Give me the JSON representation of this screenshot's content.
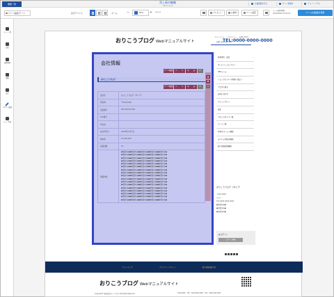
{
  "topbar": {
    "function_button": "機能一覧",
    "page_title": "売上高の編集",
    "page_subtitle": "2013-11-14",
    "links": [
      {
        "label": "企業概要を見る"
      },
      {
        "label": "サイト情報を"
      },
      {
        "label": "チュートリアル"
      }
    ]
  },
  "toolbar": {
    "parts_button": "パーツ編集モード",
    "display_device_label": "表示デバイス",
    "zoom_label": "ズーム：",
    "zoom_value": "85",
    "zoom_unit": "%",
    "zoom_minus": "−",
    "zoom_plus": "+",
    "ellipsis": "•••",
    "preview": "プレビュー",
    "publish": "公開中",
    "page_settings": "ページ設定",
    "edit_time_label": "ページ操作時間：",
    "edit_time_value": "2019/04/23 14:51:03",
    "save_button": "ページの編集を保存"
  },
  "sidebar": {
    "items": [
      {
        "label": "ページ一覧"
      },
      {
        "label": "追加"
      },
      {
        "label": "画像管理"
      },
      {
        "label": "履歴"
      },
      {
        "label": "表示"
      },
      {
        "label": "デザイン編集"
      },
      {
        "label": "ページ作成"
      }
    ]
  },
  "site": {
    "logo": "おりこうブログ",
    "logo_sub": "Webマニュアルサイト",
    "header_links": "・サイトマップ　・プライバシー　・お問い合わせ",
    "contact_label": "お問い合わせはこちら",
    "tel": "TEL:0000-0000-0000",
    "page_heading": "会社情報",
    "section_heading": "おりこうブログ",
    "controls": {
      "edit": "パーツ編集",
      "icons": [
        "⇔",
        "✎",
        "⧉",
        "▮",
        "✕"
      ],
      "up": "▲",
      "down": "▼",
      "plus": "+"
    },
    "table": [
      {
        "key": "会社名",
        "value": "おりこうブログ（ダミア）"
      },
      {
        "key": "所在地",
        "value": "〒000-0000"
      },
      {
        "key": "電話番号",
        "value": "000-0000-0000"
      },
      {
        "key": "FAX番号",
        "value": ""
      },
      {
        "key": "代表者",
        "value": ""
      },
      {
        "key": "設立年月日",
        "value": "2009年11月1日"
      },
      {
        "key": "資本金",
        "value": "10,000,000"
      },
      {
        "key": "従業員数",
        "value": "10"
      }
    ],
    "business_key": "事業内容",
    "business_lines": [
      "●事業内容●●事業内容●●事業内容●●事業内容●●事業内容●",
      "●事業内容●●事業内容●●事業内容●●事業内容●●事業内容●",
      "●事業内容●●事業内容●●事業内容●●事業内容●●事業内容●",
      "●事業内容●●事業内容●●事業内容●●事業内容●●事業内容●",
      "●事業内容●●事業内容●●事業内容●●事業内容●●事業内容●",
      "●事業内容●●事業内容●●事業内容●●事業内容●●事業内容●",
      "●事業内容●●事業内容●●事業内容●●事業内容●●事業内容●",
      "●事業内容●●事業内容●●事業内容●●事業内容●●事業内容●",
      "●事業内容●●事業内容●●事業内容●●事業内容●●事業内容●",
      "●事業内容●●事業内容●●事業内容●●事業内容●●事業内容●",
      "●事業内容●●事業内容●●事業内容●●事業内容●●事業内容●",
      "●事業内容●●事業内容●●事業内容●●事業内容●●事業内容●",
      "●事業内容●●事業内容●●事業内容●●事業内容●●事業内容●",
      "●事業内容●●事業内容●●事業内容●●事業内容●●事業内容●",
      "●事業内容●●事業内容●●事業内容●●事業内容●●事業内容●",
      "●事業内容●●事業内容●●事業内容●●事業内容●●事業内容●",
      "●事業内容●●事業内容●●事業内容●●事業内容●●事業内容●"
    ],
    "side_nav": [
      "基本操作・設定",
      "ホームページについて",
      "SEOツール",
      "トピックス データ管理一覧ビー",
      "ブログの書き",
      "お問い合わせ",
      "チャットボット",
      "設定",
      "ブロックタイプ一覧",
      "パーツ一覧",
      "有料オプション機能",
      "モバイル用表示機能",
      "個人情報保護機能"
    ],
    "side_company": "おりこうブログ（ダミア）",
    "side_address": [
      "〒000-0000",
      "テスト",
      "TEL:0000-0000-0000",
      "●事業内容●",
      "●事業内容●",
      "●事業内容●"
    ],
    "login_label": "◆ ログイン",
    "login_button": "ログイン画面",
    "footer_links": [
      "サイトマップ",
      "プライバシーポリシー",
      "個人情報保護方針"
    ],
    "footer_logo": "おりこうブログ",
    "footer_logo_sub": "Webマニュアルサイト",
    "copyright": "Copyright© 株式会社ダミアブログ All Rights Reserved.",
    "footer_address": "〒000-0000　TEL：000-0000-0000　FAX：0000-000-0000"
  }
}
